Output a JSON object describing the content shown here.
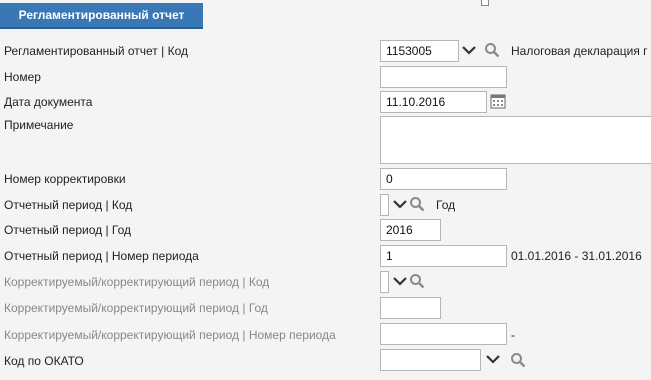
{
  "header": {
    "tab_label": "Регламентированный отчет"
  },
  "fields": {
    "report_code": {
      "label": "Регламентированный отчет | Код",
      "value": "1153005",
      "description": "Налоговая декларация г"
    },
    "number": {
      "label": "Номер",
      "value": ""
    },
    "doc_date": {
      "label": "Дата документа",
      "value": "11.10.2016"
    },
    "note": {
      "label": "Примечание",
      "value": ""
    },
    "correction_number": {
      "label": "Номер корректировки",
      "value": "0"
    },
    "period_code": {
      "label": "Отчетный период | Код",
      "value": "",
      "description": "Год"
    },
    "period_year": {
      "label": "Отчетный период | Год",
      "value": "2016"
    },
    "period_number": {
      "label": "Отчетный период | Номер периода",
      "value": "1",
      "description": "01.01.2016 - 31.01.2016"
    },
    "corr_period_code": {
      "label": "Корректируемый/корректирующий период | Код",
      "value": ""
    },
    "corr_period_year": {
      "label": "Корректируемый/корректирующий период | Год",
      "value": ""
    },
    "corr_period_number": {
      "label": "Корректируемый/корректирующий период | Номер периода",
      "value": "",
      "description": "-"
    },
    "okato": {
      "label": "Код по ОКАТО",
      "value": ""
    }
  },
  "icons": {
    "dropdown": "chevron-down-icon",
    "search": "search-icon",
    "calendar": "calendar-icon"
  },
  "colors": {
    "tab": "#3a78b5",
    "background": "#f4f4f4",
    "label_disabled": "#888888"
  }
}
